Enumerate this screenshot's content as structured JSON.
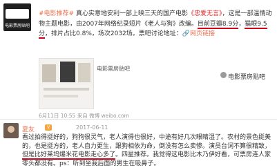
{
  "post1": {
    "avatar_text": "电影票房贴吧",
    "text_parts": [
      {
        "t": "#电影推荐#",
        "cls": "tag"
      },
      {
        "t": " 真心实意地安利一部上映三天的国产电影",
        "cls": ""
      },
      {
        "t": "《忠爱无言》",
        "cls": "red"
      },
      {
        "t": "，这是一部温情动物主题电影，由2007年网络纪录短片《老人与狗》改编。",
        "cls": ""
      },
      {
        "t": "目前豆瓣8.9分",
        "cls": "ul"
      },
      {
        "t": "，",
        "cls": ""
      },
      {
        "t": "猫眼9.5分",
        "cls": "ul"
      },
      {
        "t": "，排片占比0.8%，场次2032场。票吧讨论地址：",
        "cls": ""
      },
      {
        "t": "🔗网页链接",
        "cls": "lnk"
      }
    ],
    "share_label": "电影票房贴吧",
    "meta": "6月11日 10:55 来自 微博 weibo.com"
  },
  "brand": {
    "name": "电影票房贴吧"
  },
  "post2": {
    "username": "夏友",
    "time": "2017-06-11",
    "comment_parts": [
      {
        "t": "看过",
        "cls": ""
      },
      {
        "t": "拍得挺好的，狗狗很灵气，老人演得也很好，中途有好几次眼睛湿了。农村的景色挺美的，也是挺方的，老人自力更生，跟狗相依为命，倒没有怎么卖惨。演员台词不算很精致，",
        "cls": ""
      },
      {
        "t": "但是比好莱坞爆米花电影走心多了",
        "cls": "ul"
      },
      {
        "t": "。四星推荐。我觉得这电影比木乃伊好看，可票房连人家零头都没有。ps：听到坐我后面的男生在吸鼻子。",
        "cls": ""
      }
    ]
  }
}
